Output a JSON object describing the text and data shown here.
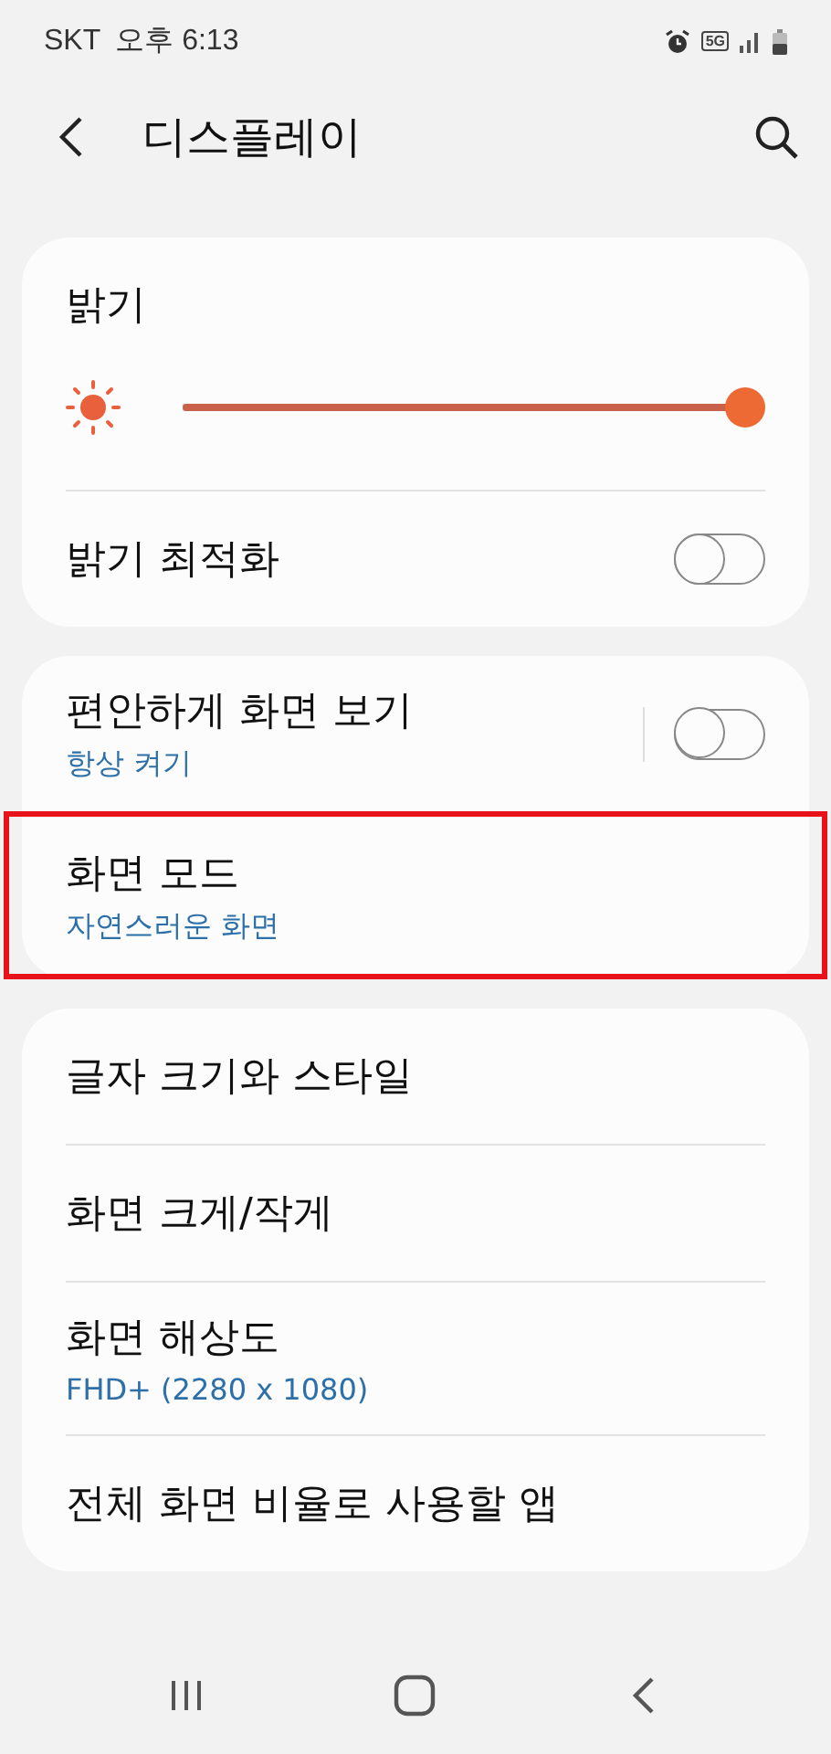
{
  "status_bar": {
    "carrier": "SKT",
    "time": "오후 6:13",
    "network": "5G"
  },
  "header": {
    "title": "디스플레이"
  },
  "cards": [
    {
      "items": [
        {
          "kind": "slider",
          "title": "밝기",
          "level": 1.0
        },
        {
          "kind": "toggle",
          "title": "밝기 최적화",
          "on": false,
          "split": false,
          "highlighted": false
        }
      ]
    },
    {
      "items": [
        {
          "kind": "toggle",
          "title": "편안하게 화면 보기",
          "subtitle": "항상 켜기",
          "on": false,
          "split": true,
          "highlighted": false
        },
        {
          "kind": "nav",
          "title": "화면 모드",
          "subtitle": "자연스러운 화면",
          "highlighted": true
        }
      ]
    },
    {
      "items": [
        {
          "kind": "nav",
          "title": "글자 크기와 스타일",
          "highlighted": false
        },
        {
          "kind": "nav",
          "title": "화면 크게/작게",
          "highlighted": false
        },
        {
          "kind": "nav",
          "title": "화면 해상도",
          "subtitle": "FHD+ (2280 x 1080)",
          "highlighted": false
        },
        {
          "kind": "nav",
          "title": "전체 화면 비율로 사용할 앱",
          "highlighted": false
        }
      ]
    }
  ]
}
